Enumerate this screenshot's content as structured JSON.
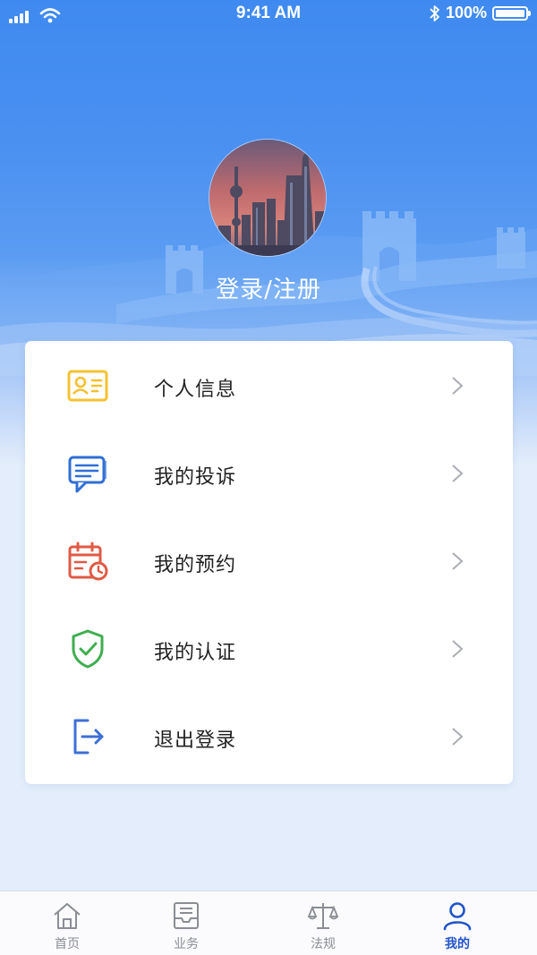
{
  "status_bar": {
    "time": "9:41 AM",
    "battery": "100%",
    "battery_level": 1.0
  },
  "profile": {
    "login_label": "登录/注册"
  },
  "menu": {
    "items": [
      {
        "label": "个人信息",
        "icon": "id-card-icon",
        "color": "#f5c12e"
      },
      {
        "label": "我的投诉",
        "icon": "message-icon",
        "color": "#2f6fd6"
      },
      {
        "label": "我的预约",
        "icon": "calendar-clock-icon",
        "color": "#e05a45"
      },
      {
        "label": "我的认证",
        "icon": "shield-check-icon",
        "color": "#3fae4f"
      },
      {
        "label": "退出登录",
        "icon": "logout-icon",
        "color": "#3d6fd6"
      }
    ]
  },
  "tab_bar": {
    "tabs": [
      {
        "label": "首页",
        "icon": "home-icon",
        "active": false
      },
      {
        "label": "业务",
        "icon": "inbox-icon",
        "active": false
      },
      {
        "label": "法规",
        "icon": "scales-icon",
        "active": false
      },
      {
        "label": "我的",
        "icon": "person-icon",
        "active": true
      }
    ],
    "active_color": "#2154c8",
    "inactive_color": "#8a8d94"
  },
  "colors": {
    "hero_blue": "#4a90f1",
    "page_background": "#e3edfb"
  }
}
